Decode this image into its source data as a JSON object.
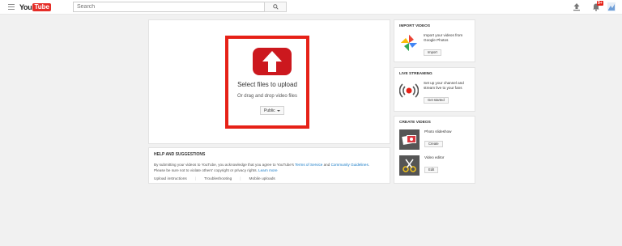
{
  "masthead": {
    "logo_you": "You",
    "logo_tube": "Tube",
    "search_placeholder": "Search",
    "notification_count": "9+"
  },
  "upload": {
    "title": "Select files to upload",
    "subtitle": "Or drag and drop video files",
    "privacy": "Public"
  },
  "help": {
    "title": "HELP AND SUGGESTIONS",
    "text_1": "By submitting your videos to YouTube, you acknowledge that you agree to YouTube's ",
    "tos": "Terms of Service",
    "and": " and ",
    "guidelines": "Community Guidelines",
    "text_2": ".",
    "text_3": "Please be sure not to violate others' copyright or privacy rights. ",
    "learn_more": "Learn more",
    "links": [
      "Upload instructions",
      "Troubleshooting",
      "Mobile uploads"
    ]
  },
  "sidebar": {
    "import": {
      "title": "IMPORT VIDEOS",
      "desc": "Import your videos from Google Photos",
      "button": "Import"
    },
    "live": {
      "title": "LIVE STREAMING",
      "desc": "Set up your channel and stream live to your fans",
      "button": "Get started"
    },
    "create": {
      "title": "CREATE VIDEOS",
      "items": [
        {
          "label": "Photo slideshow",
          "button": "Create"
        },
        {
          "label": "Video editor",
          "button": "Edit"
        }
      ]
    }
  },
  "colors": {
    "accent_red": "#e62117",
    "link_blue": "#167ac6"
  }
}
